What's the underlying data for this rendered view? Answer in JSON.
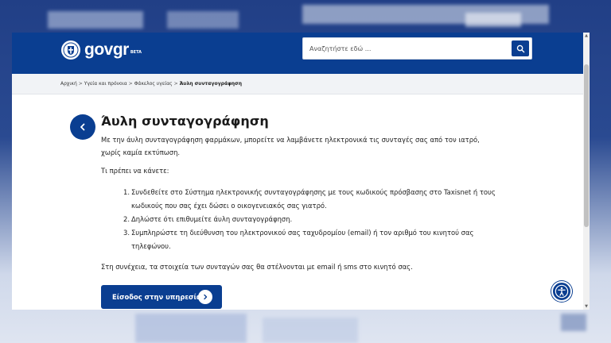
{
  "header": {
    "logo_text_a": "gov",
    "logo_text_b": "gr",
    "logo_beta": "BETA",
    "search_placeholder": "Αναζητήστε εδώ ..."
  },
  "breadcrumb": {
    "items": [
      "Αρχική",
      "Υγεία και πρόνοια",
      "Φάκελος υγείας"
    ],
    "current": "Άυλη συνταγογράφηση",
    "separator": ">"
  },
  "main": {
    "title": "Άυλη συνταγογράφηση",
    "intro": "Με την άυλη συνταγογράφηση φαρμάκων, μπορείτε να λαμβάνετε ηλεκτρονικά τις συνταγές σας από τον ιατρό, χωρίς καμία εκτύπωση.",
    "what_to_do": "Τι πρέπει να κάνετε:",
    "steps": [
      {
        "num": "1.",
        "text": "Συνδεθείτε στο Σύστημα ηλεκτρονικής συνταγογράφησης με τους κωδικούς πρόσβασης στο Taxisnet ή τους κωδικούς που σας έχει δώσει ο οικογενειακός σας γιατρό."
      },
      {
        "num": "2.",
        "text": "Δηλώστε ότι επιθυμείτε άυλη συνταγογράφηση."
      },
      {
        "num": "3.",
        "text": "Συμπληρώστε τη διεύθυνση του ηλεκτρονικού σας ταχυδρομίου (email) ή τον αριθμό του κινητού σας τηλεφώνου."
      }
    ],
    "outro": "Στη συνέχεια, τα στοιχεία των συνταγών σας θα στέλνονται με email ή sms στο κινητό σας.",
    "cta_label": "Είσοδος στην υπηρεσία"
  },
  "colors": {
    "brand": "#0a3e91",
    "breadcrumb_bg": "#f1f3f6"
  }
}
